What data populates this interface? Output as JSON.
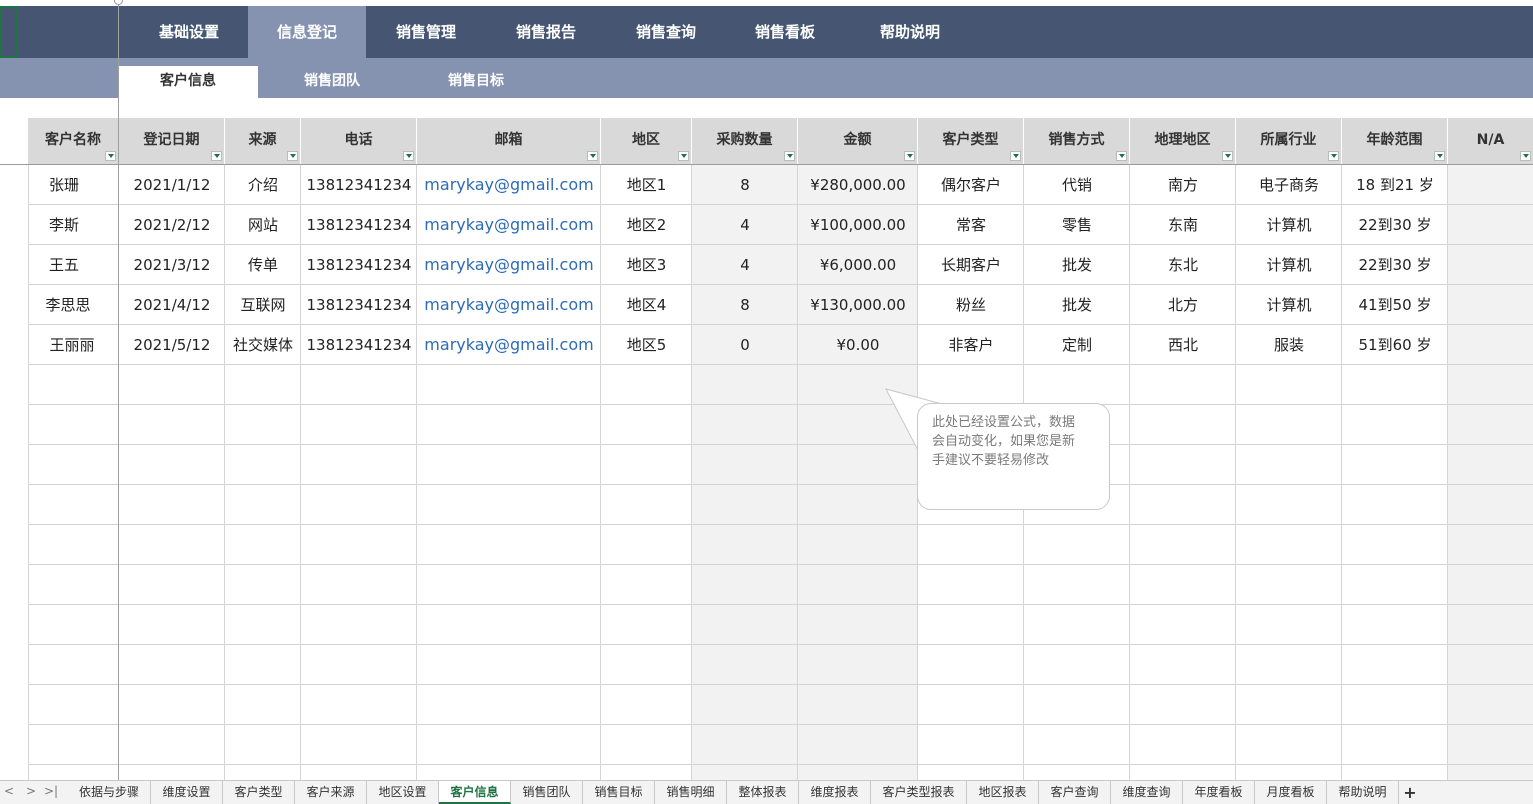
{
  "main_nav": [
    "基础设置",
    "信息登记",
    "销售管理",
    "销售报告",
    "销售查询",
    "销售看板",
    "帮助说明"
  ],
  "main_nav_active": "信息登记",
  "sub_nav": [
    "客户信息",
    "销售团队",
    "销售目标"
  ],
  "sub_nav_active": "客户信息",
  "table": {
    "headers": [
      "客户名称",
      "登记日期",
      "来源",
      "电话",
      "邮箱",
      "地区",
      "采购数量",
      "金额",
      "客户类型",
      "销售方式",
      "地理地区",
      "所属行业",
      "年龄范围",
      "N/A"
    ],
    "rows": [
      [
        "张珊",
        "2021/1/12",
        "介绍",
        "13812341234",
        "marykay@gmail.com",
        "地区1",
        "8",
        "¥280,000.00",
        "偶尔客户",
        "代销",
        "南方",
        "电子商务",
        "18 到21 岁",
        ""
      ],
      [
        "李斯",
        "2021/2/12",
        "网站",
        "13812341234",
        "marykay@gmail.com",
        "地区2",
        "4",
        "¥100,000.00",
        "常客",
        "零售",
        "东南",
        "计算机",
        "22到30 岁",
        ""
      ],
      [
        "王五",
        "2021/3/12",
        "传单",
        "13812341234",
        "marykay@gmail.com",
        "地区3",
        "4",
        "¥6,000.00",
        "长期客户",
        "批发",
        "东北",
        "计算机",
        "22到30 岁",
        ""
      ],
      [
        "李思思",
        "2021/4/12",
        "互联网",
        "13812341234",
        "marykay@gmail.com",
        "地区4",
        "8",
        "¥130,000.00",
        "粉丝",
        "批发",
        "北方",
        "计算机",
        "41到50 岁",
        ""
      ],
      [
        "王丽丽",
        "2021/5/12",
        "社交媒体",
        "13812341234",
        "marykay@gmail.com",
        "地区5",
        "0",
        "¥0.00",
        "非客户",
        "定制",
        "西北",
        "服装",
        "51到60 岁",
        ""
      ]
    ]
  },
  "callout": {
    "line1": "此处已经设置公式，数据",
    "line2": "会自动变化，如果您是新",
    "line3": "手建议不要轻易修改"
  },
  "sheet_tabs": [
    "依据与步骤",
    "维度设置",
    "客户类型",
    "客户来源",
    "地区设置",
    "客户信息",
    "销售团队",
    "销售目标",
    "销售明细",
    "整体报表",
    "维度报表",
    "客户类型报表",
    "地区报表",
    "客户查询",
    "维度查询",
    "年度看板",
    "月度看板",
    "帮助说明"
  ],
  "sheet_active": "客户信息",
  "colors": {
    "nav_bg": "#465672",
    "nav_active": "#8593b0",
    "accent": "#217346",
    "link": "#2e6bb5"
  }
}
